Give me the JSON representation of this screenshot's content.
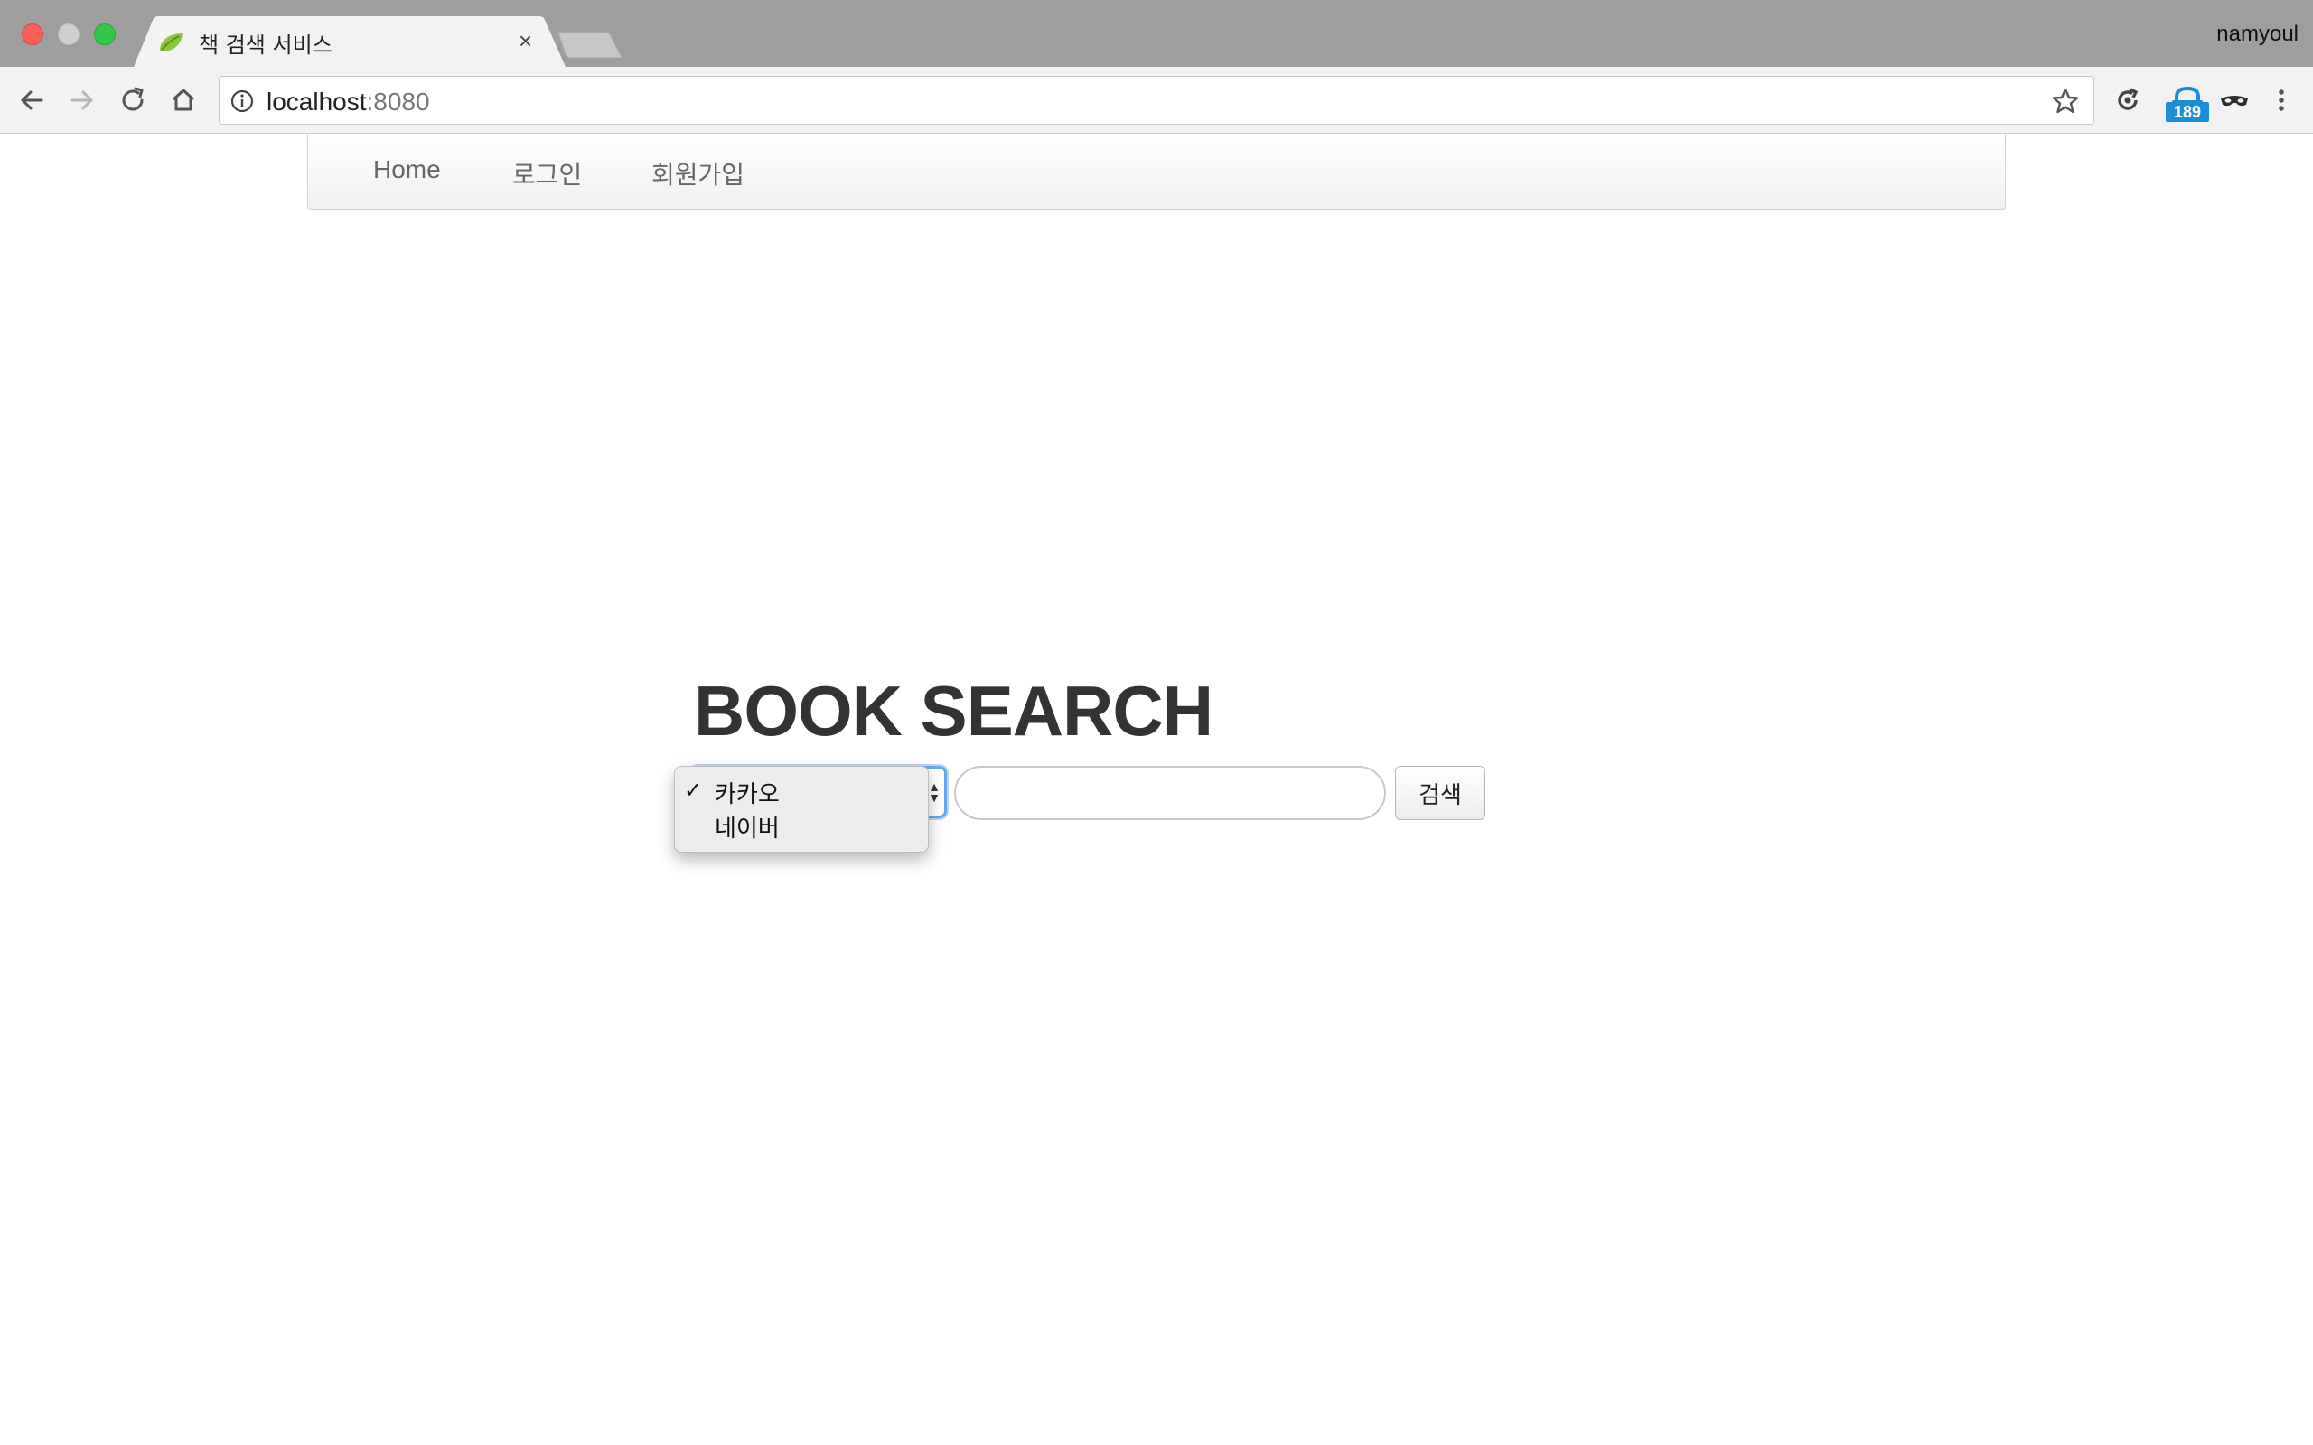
{
  "browser": {
    "tab_title": "책 검색 서비스",
    "tab_close": "×",
    "profile_name": "namyoul",
    "url_host": "localhost",
    "url_port": ":8080",
    "extension_badge": "189"
  },
  "nav": {
    "home": "Home",
    "login": "로그인",
    "signup": "회원가입"
  },
  "main": {
    "title": "BOOK SEARCH",
    "source_select": {
      "options": [
        "카카오",
        "네이버"
      ],
      "selected": "카카오",
      "check_mark": "✓"
    },
    "search_input": {
      "value": "",
      "placeholder": ""
    },
    "search_button": "검색"
  },
  "colors": {
    "titlebar": "#9e9e9e",
    "toolbar": "#f2f2f2",
    "focus_ring": "#6aa4ef",
    "title_text": "#333333",
    "extension_badge": "#1a8fd6"
  }
}
